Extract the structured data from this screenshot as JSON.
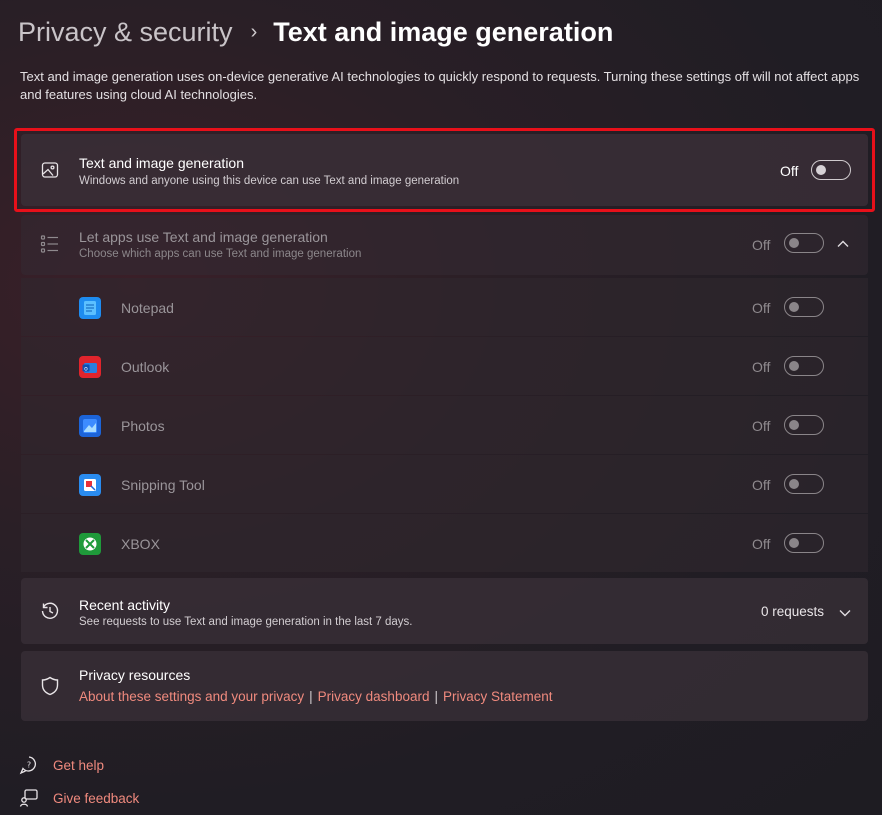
{
  "breadcrumb": {
    "parent": "Privacy & security",
    "separator": "›",
    "current": "Text and image generation"
  },
  "description": "Text and image generation uses on-device generative AI technologies to quickly respond to requests. Turning these settings off will not affect apps and features using cloud AI technologies.",
  "main_setting": {
    "icon": "image-icon",
    "title": "Text and image generation",
    "subtitle": "Windows and anyone using this device can use Text and image generation",
    "state_label": "Off",
    "enabled": false
  },
  "apps_group": {
    "icon": "list-icon",
    "title": "Let apps use Text and image generation",
    "subtitle": "Choose which apps can use Text and image generation",
    "state_label": "Off",
    "enabled": false,
    "apps": [
      {
        "name": "Notepad",
        "icon": "notepad-icon",
        "state_label": "Off",
        "color": "#1e8cf0"
      },
      {
        "name": "Outlook",
        "icon": "outlook-icon",
        "state_label": "Off",
        "color": "#e0242c"
      },
      {
        "name": "Photos",
        "icon": "photos-icon",
        "state_label": "Off",
        "color": "#1c64d8"
      },
      {
        "name": "Snipping Tool",
        "icon": "snipping-tool-icon",
        "state_label": "Off",
        "color": "#2a8cf0"
      },
      {
        "name": "XBOX",
        "icon": "xbox-icon",
        "state_label": "Off",
        "color": "#1f9a3a"
      }
    ]
  },
  "recent_activity": {
    "icon": "history-icon",
    "title": "Recent activity",
    "subtitle": "See requests to use Text and image generation in the last 7 days.",
    "count_label": "0 requests"
  },
  "privacy_resources": {
    "icon": "shield-icon",
    "title": "Privacy resources",
    "links": [
      "About these settings and your privacy",
      "Privacy dashboard",
      "Privacy Statement"
    ]
  },
  "footer": {
    "get_help": "Get help",
    "give_feedback": "Give feedback"
  },
  "colors": {
    "accent_link": "#f08a7e",
    "highlight": "#e8101a"
  }
}
